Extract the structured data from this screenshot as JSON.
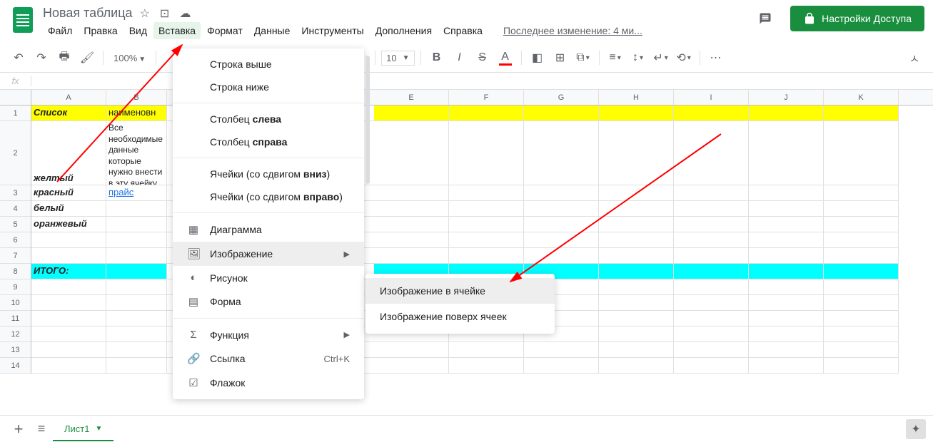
{
  "doc_title": "Новая таблица",
  "menu": {
    "file": "Файл",
    "edit": "Правка",
    "view": "Вид",
    "insert": "Вставка",
    "format": "Формат",
    "data": "Данные",
    "tools": "Инструменты",
    "addons": "Дополнения",
    "help": "Справка",
    "last_edit": "Последнее изменение: 4 ми..."
  },
  "share_button": "Настройки Доступа",
  "toolbar": {
    "zoom": "100%",
    "font_size": "10"
  },
  "columns": [
    "A",
    "B",
    "E",
    "F",
    "G",
    "H",
    "I",
    "J",
    "K"
  ],
  "rows": [
    "1",
    "2",
    "3",
    "4",
    "5",
    "6",
    "7",
    "8",
    "9",
    "10",
    "11",
    "12",
    "13",
    "14"
  ],
  "cells": {
    "A1": "Список",
    "B1": "наименовн",
    "B2": "Все необходимые данные которые нужно внести в эту ячейку",
    "A2b": "желтый",
    "A3": "красный",
    "B3": "прайс",
    "A4": "белый",
    "A5": "оранжевый",
    "A8": "ИТОГО:"
  },
  "dropdown": {
    "row_above": "Строка выше",
    "row_below": "Строка ниже",
    "col_left_1": "Столбец ",
    "col_left_2": "слева",
    "col_right_1": "Столбец ",
    "col_right_2": "справа",
    "cells_down_1": "Ячейки (со сдвигом ",
    "cells_down_2": "вниз",
    "cells_down_3": ")",
    "cells_right_1": "Ячейки (со сдвигом ",
    "cells_right_2": "вправо",
    "cells_right_3": ")",
    "chart": "Диаграмма",
    "image": "Изображение",
    "drawing": "Рисунок",
    "form": "Форма",
    "function": "Функция",
    "link": "Ссылка",
    "link_shortcut": "Ctrl+K",
    "checkbox": "Флажок"
  },
  "submenu": {
    "in_cell": "Изображение в ячейке",
    "over_cells": "Изображение поверх ячеек"
  },
  "sheet_tab": "Лист1"
}
